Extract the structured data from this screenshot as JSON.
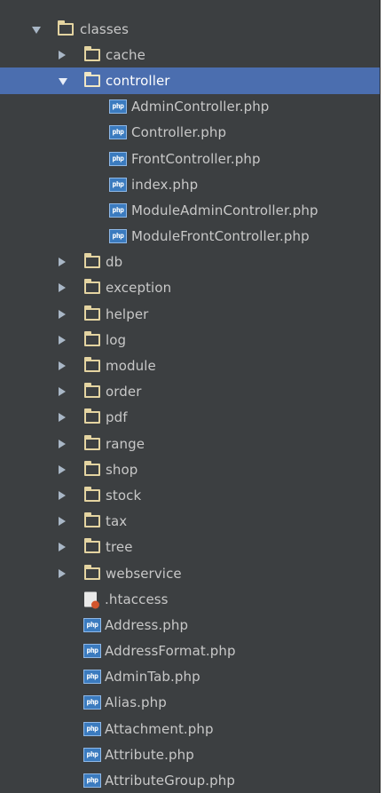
{
  "tree": {
    "root": {
      "label": "classes"
    },
    "folders_top": [
      {
        "label": "cache"
      },
      {
        "label": "controller"
      }
    ],
    "controller_files": [
      {
        "label": "AdminController.php"
      },
      {
        "label": "Controller.php"
      },
      {
        "label": "FrontController.php"
      },
      {
        "label": "index.php"
      },
      {
        "label": "ModuleAdminController.php"
      },
      {
        "label": "ModuleFrontController.php"
      }
    ],
    "folders": [
      {
        "label": "db"
      },
      {
        "label": "exception"
      },
      {
        "label": "helper"
      },
      {
        "label": "log"
      },
      {
        "label": "module"
      },
      {
        "label": "order"
      },
      {
        "label": "pdf"
      },
      {
        "label": "range"
      },
      {
        "label": "shop"
      },
      {
        "label": "stock"
      },
      {
        "label": "tax"
      },
      {
        "label": "tree"
      },
      {
        "label": "webservice"
      }
    ],
    "htaccess": {
      "label": ".htaccess"
    },
    "files": [
      {
        "label": "Address.php"
      },
      {
        "label": "AddressFormat.php"
      },
      {
        "label": "AdminTab.php"
      },
      {
        "label": "Alias.php"
      },
      {
        "label": "Attachment.php"
      },
      {
        "label": "Attribute.php"
      },
      {
        "label": "AttributeGroup.php"
      }
    ],
    "file_icon_text": "php"
  },
  "colors": {
    "panel_background": "#3c3f41",
    "selection": "#4b6eaf",
    "text": "#c8c8c8",
    "folder": "#e4d4a1",
    "php_icon": "#3b7bbf"
  }
}
